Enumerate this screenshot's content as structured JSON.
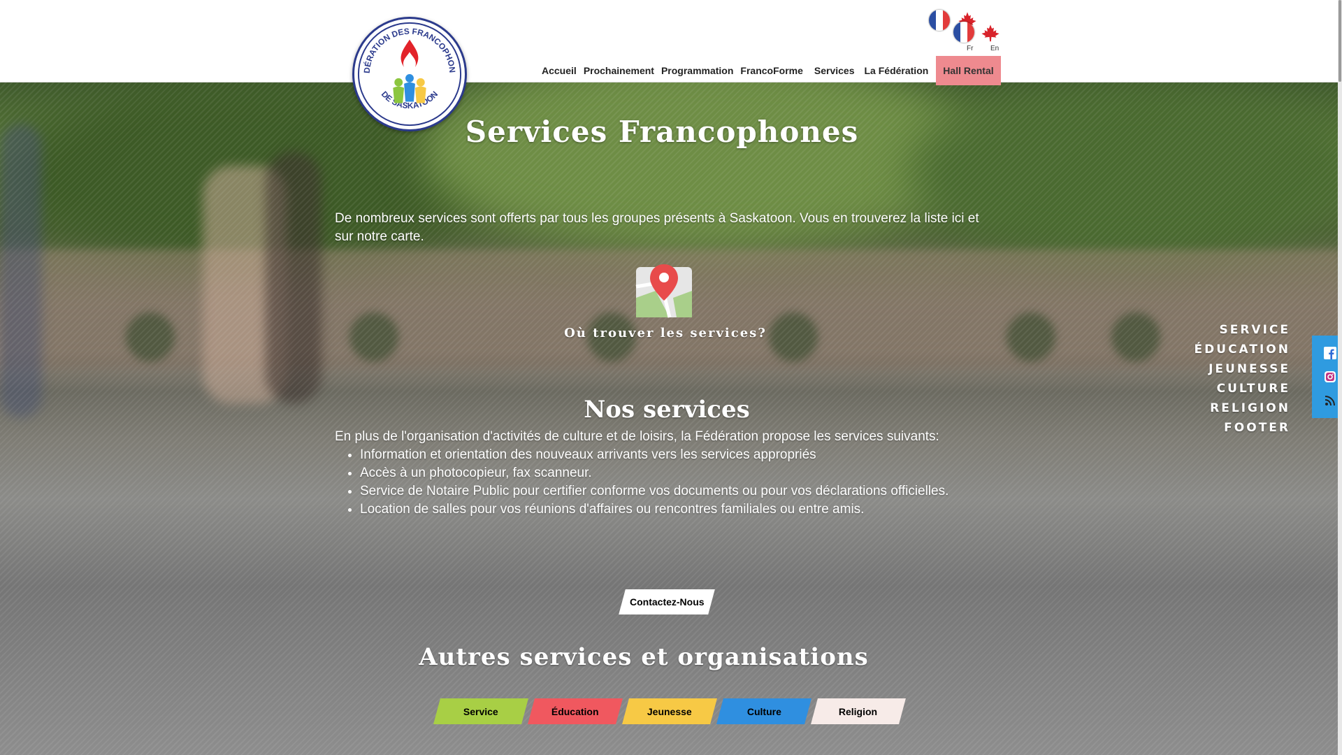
{
  "header": {
    "logo": {
      "top_text": "FÉDÉRATION DES FRANCOPHONES",
      "bottom_text": "DE SASKATOON"
    },
    "nav": [
      {
        "label": "Accueil"
      },
      {
        "label": "Prochainement"
      },
      {
        "label": "Programmation"
      },
      {
        "label": "FrancoForme"
      },
      {
        "label": "Services"
      },
      {
        "label": "La Fédération"
      },
      {
        "label": "Hall Rental",
        "active": true
      }
    ],
    "languages": [
      {
        "code": "Fr"
      },
      {
        "code": "En"
      }
    ],
    "active_color": "#ee8a8f"
  },
  "hero": {
    "title": "Services Francophones",
    "intro": "De nombreux services sont offerts par tous les groupes présents à Saskatoon. Vous en trouverez la liste ici et sur notre carte.",
    "map_link": "Où trouver les services?"
  },
  "our_services": {
    "title": "Nos services",
    "lead": "En plus de l'organisation d'activités de culture et de loisirs, la Fédération propose les services suivants:",
    "items": [
      "Information et orientation des nouveaux arrivants vers les services appropriés",
      "Accès à un photocopieur, fax scanneur.",
      "Service de Notaire Public pour certifier conforme vos documents ou pour vos déclarations officielles.",
      "Location de salles pour vos réunions d'affaires ou rencontres familiales ou entre amis."
    ],
    "contact_button": "Contactez-Nous"
  },
  "other": {
    "title": "Autres services et organisations",
    "categories": [
      {
        "label": "Service",
        "color": "#a8cf45"
      },
      {
        "label": "Éducation",
        "color": "#f0585f"
      },
      {
        "label": "Jeunesse",
        "color": "#f7c945"
      },
      {
        "label": "Culture",
        "color": "#2f8fe0"
      },
      {
        "label": "Religion",
        "color": "#f7ebe8"
      }
    ]
  },
  "quick_menu": [
    "SERVICE",
    "ÉDUCATION",
    "JEUNESSE",
    "CULTURE",
    "RELIGION",
    "FOOTER"
  ],
  "social": [
    {
      "icon": "facebook-icon"
    },
    {
      "icon": "instagram-icon"
    },
    {
      "icon": "rss-icon"
    }
  ]
}
